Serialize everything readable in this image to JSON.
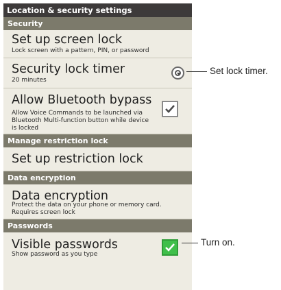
{
  "header": {
    "title": "Location & security settings"
  },
  "sections": {
    "security": "Security",
    "manage_restriction_lock": "Manage restriction lock",
    "data_encryption": "Data encryption",
    "passwords": "Passwords"
  },
  "items": {
    "screen_lock": {
      "title": "Set up screen lock",
      "subtitle": "Lock screen with a pattern, PIN, or password"
    },
    "lock_timer": {
      "title": "Security lock timer",
      "subtitle": "20 minutes"
    },
    "bluetooth_bypass": {
      "title": "Allow Bluetooth bypass",
      "subtitle_line1": "Allow Voice Commands to be launched via",
      "subtitle_line2": "Bluetooth Multi-function button while device",
      "subtitle_line3": "is locked",
      "checked": true
    },
    "restriction_lock": {
      "title": "Set up restriction lock"
    },
    "data_encryption": {
      "title": "Data encryption",
      "subtitle_line1": "Protect the data on your phone or memory card.",
      "subtitle_line2": "Requires screen lock"
    },
    "visible_passwords": {
      "title": "Visible passwords",
      "subtitle": "Show password as you type",
      "checked": true
    }
  },
  "callouts": {
    "lock_timer": "Set lock timer.",
    "turn_on": "Turn on."
  },
  "colors": {
    "title_bar": "#3d3a3a",
    "section_header": "#7c7a6b",
    "list_bg": "#eeece3",
    "check_green": "#3fbf4a"
  }
}
